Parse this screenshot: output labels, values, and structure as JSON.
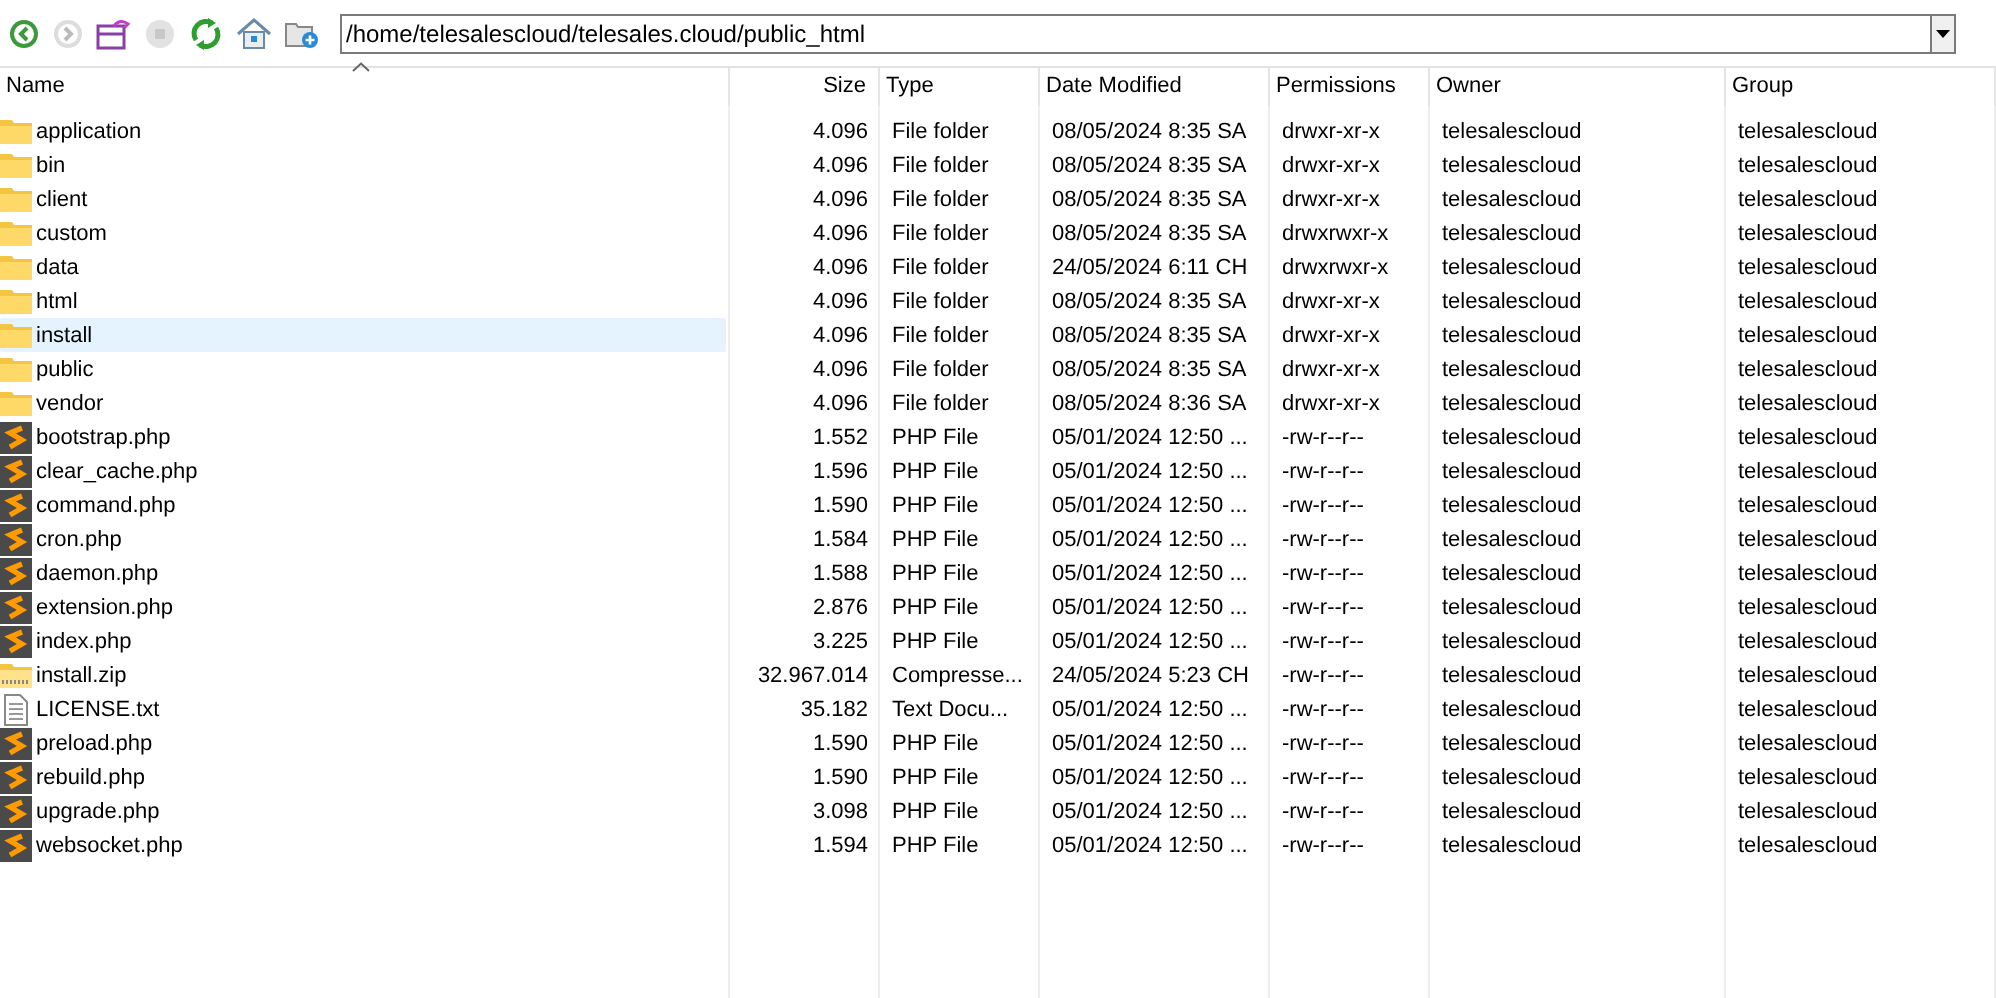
{
  "toolbar": {
    "buttons": [
      {
        "kind": "back",
        "disabled": false
      },
      {
        "kind": "forward",
        "disabled": true
      },
      {
        "kind": "sync",
        "disabled": false
      },
      {
        "kind": "stop",
        "disabled": true
      },
      {
        "kind": "refresh",
        "disabled": false
      },
      {
        "kind": "home",
        "disabled": false
      },
      {
        "kind": "new-folder",
        "disabled": false
      }
    ],
    "path": "/home/telesalescloud/telesales.cloud/public_html"
  },
  "table": {
    "columns": [
      "Name",
      "Size",
      "Type",
      "Date Modified",
      "Permissions",
      "Owner",
      "Group"
    ],
    "rows": [
      {
        "kind": "folder",
        "selected": false,
        "cells": [
          "application",
          "4.096",
          "File folder",
          "08/05/2024 8:35 SA",
          "drwxr-xr-x",
          "telesalescloud",
          "telesalescloud"
        ]
      },
      {
        "kind": "folder",
        "selected": false,
        "cells": [
          "bin",
          "4.096",
          "File folder",
          "08/05/2024 8:35 SA",
          "drwxr-xr-x",
          "telesalescloud",
          "telesalescloud"
        ]
      },
      {
        "kind": "folder",
        "selected": false,
        "cells": [
          "client",
          "4.096",
          "File folder",
          "08/05/2024 8:35 SA",
          "drwxr-xr-x",
          "telesalescloud",
          "telesalescloud"
        ]
      },
      {
        "kind": "folder",
        "selected": false,
        "cells": [
          "custom",
          "4.096",
          "File folder",
          "08/05/2024 8:35 SA",
          "drwxrwxr-x",
          "telesalescloud",
          "telesalescloud"
        ]
      },
      {
        "kind": "folder",
        "selected": false,
        "cells": [
          "data",
          "4.096",
          "File folder",
          "24/05/2024 6:11 CH",
          "drwxrwxr-x",
          "telesalescloud",
          "telesalescloud"
        ]
      },
      {
        "kind": "folder",
        "selected": false,
        "cells": [
          "html",
          "4.096",
          "File folder",
          "08/05/2024 8:35 SA",
          "drwxr-xr-x",
          "telesalescloud",
          "telesalescloud"
        ]
      },
      {
        "kind": "folder",
        "selected": true,
        "cells": [
          "install",
          "4.096",
          "File folder",
          "08/05/2024 8:35 SA",
          "drwxr-xr-x",
          "telesalescloud",
          "telesalescloud"
        ]
      },
      {
        "kind": "folder",
        "selected": false,
        "cells": [
          "public",
          "4.096",
          "File folder",
          "08/05/2024 8:35 SA",
          "drwxr-xr-x",
          "telesalescloud",
          "telesalescloud"
        ]
      },
      {
        "kind": "folder",
        "selected": false,
        "cells": [
          "vendor",
          "4.096",
          "File folder",
          "08/05/2024 8:36 SA",
          "drwxr-xr-x",
          "telesalescloud",
          "telesalescloud"
        ]
      },
      {
        "kind": "php",
        "selected": false,
        "cells": [
          "bootstrap.php",
          "1.552",
          "PHP File",
          "05/01/2024 12:50 ...",
          "-rw-r--r--",
          "telesalescloud",
          "telesalescloud"
        ]
      },
      {
        "kind": "php",
        "selected": false,
        "cells": [
          "clear_cache.php",
          "1.596",
          "PHP File",
          "05/01/2024 12:50 ...",
          "-rw-r--r--",
          "telesalescloud",
          "telesalescloud"
        ]
      },
      {
        "kind": "php",
        "selected": false,
        "cells": [
          "command.php",
          "1.590",
          "PHP File",
          "05/01/2024 12:50 ...",
          "-rw-r--r--",
          "telesalescloud",
          "telesalescloud"
        ]
      },
      {
        "kind": "php",
        "selected": false,
        "cells": [
          "cron.php",
          "1.584",
          "PHP File",
          "05/01/2024 12:50 ...",
          "-rw-r--r--",
          "telesalescloud",
          "telesalescloud"
        ]
      },
      {
        "kind": "php",
        "selected": false,
        "cells": [
          "daemon.php",
          "1.588",
          "PHP File",
          "05/01/2024 12:50 ...",
          "-rw-r--r--",
          "telesalescloud",
          "telesalescloud"
        ]
      },
      {
        "kind": "php",
        "selected": false,
        "cells": [
          "extension.php",
          "2.876",
          "PHP File",
          "05/01/2024 12:50 ...",
          "-rw-r--r--",
          "telesalescloud",
          "telesalescloud"
        ]
      },
      {
        "kind": "php",
        "selected": false,
        "cells": [
          "index.php",
          "3.225",
          "PHP File",
          "05/01/2024 12:50 ...",
          "-rw-r--r--",
          "telesalescloud",
          "telesalescloud"
        ]
      },
      {
        "kind": "zip",
        "selected": false,
        "cells": [
          "install.zip",
          "32.967.014",
          "Compresse...",
          "24/05/2024 5:23 CH",
          "-rw-r--r--",
          "telesalescloud",
          "telesalescloud"
        ]
      },
      {
        "kind": "text",
        "selected": false,
        "cells": [
          "LICENSE.txt",
          "35.182",
          "Text Docu...",
          "05/01/2024 12:50 ...",
          "-rw-r--r--",
          "telesalescloud",
          "telesalescloud"
        ]
      },
      {
        "kind": "php",
        "selected": false,
        "cells": [
          "preload.php",
          "1.590",
          "PHP File",
          "05/01/2024 12:50 ...",
          "-rw-r--r--",
          "telesalescloud",
          "telesalescloud"
        ]
      },
      {
        "kind": "php",
        "selected": false,
        "cells": [
          "rebuild.php",
          "1.590",
          "PHP File",
          "05/01/2024 12:50 ...",
          "-rw-r--r--",
          "telesalescloud",
          "telesalescloud"
        ]
      },
      {
        "kind": "php",
        "selected": false,
        "cells": [
          "upgrade.php",
          "3.098",
          "PHP File",
          "05/01/2024 12:50 ...",
          "-rw-r--r--",
          "telesalescloud",
          "telesalescloud"
        ]
      },
      {
        "kind": "php",
        "selected": false,
        "cells": [
          "websocket.php",
          "1.594",
          "PHP File",
          "05/01/2024 12:50 ...",
          "-rw-r--r--",
          "telesalescloud",
          "telesalescloud"
        ]
      }
    ]
  }
}
